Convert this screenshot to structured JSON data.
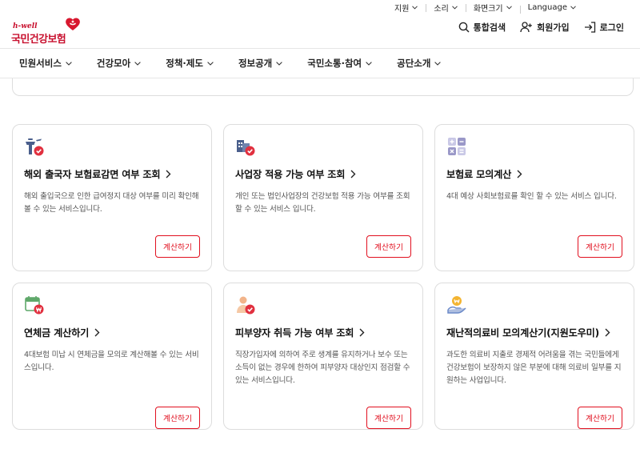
{
  "utility": [
    "지원",
    "소리",
    "화면크기",
    "Language"
  ],
  "logo": {
    "small": "h-well",
    "name": "국민건강보험"
  },
  "header_actions": {
    "search": "통합검색",
    "join": "회원가입",
    "login": "로그인"
  },
  "nav": [
    "민원서비스",
    "건강모아",
    "정책·제도",
    "정보공개",
    "국민소통·참여",
    "공단소개"
  ],
  "colors": {
    "brand": "#c8102e",
    "button": "#e1101f",
    "icon_blue": "#4a5f8c",
    "icon_lavender": "#9a98c8",
    "icon_green": "#5fa86a"
  },
  "cards": [
    {
      "icon": "airport-tower-icon",
      "title": "해외 출국자 보험료감면 여부 조회",
      "desc": "해외 출입국으로 인한 급여정지 대상 여부를 미리 확인해볼 수 있는 서비스입니다.",
      "button": "계산하기"
    },
    {
      "icon": "building-check-icon",
      "title": "사업장 적용 가능 여부 조회",
      "desc": "개인 또는 법인사업장의 건강보험 적용 가능 여부를 조회할 수 있는 서비스 입니다.",
      "button": "계산하기"
    },
    {
      "icon": "calculator-icon",
      "title": "보험료 모의계산",
      "desc": "4대 예상 사회보험료를 확인 할 수 있는 서비스 입니다.",
      "button": "계산하기"
    },
    {
      "icon": "calendar-won-icon",
      "title": "연체금 계산하기",
      "desc": "4대보험 미납 시 연체금을 모의로 계산해볼 수 있는 서비스입니다.",
      "button": "계산하기"
    },
    {
      "icon": "dependent-person-icon",
      "title": "피부양자 취득 가능 여부 조회",
      "desc": "직장가입자에 의하여 주로 생계를 유지하거나 보수 또는 소득이 없는 경우에 한하여 피부양자 대상인지 점검할 수 있는 서비스입니다.",
      "button": "계산하기"
    },
    {
      "icon": "hand-coin-icon",
      "title": "재난적의료비 모의계산기(지원도우미)",
      "desc": "과도한 의료비 지출로 경제적 어려움을 겪는 국민들에게 건강보험이 보장하지 않은 부분에 대해 의료비 일부를 지원하는 사업입니다.",
      "button": "계산하기"
    }
  ]
}
